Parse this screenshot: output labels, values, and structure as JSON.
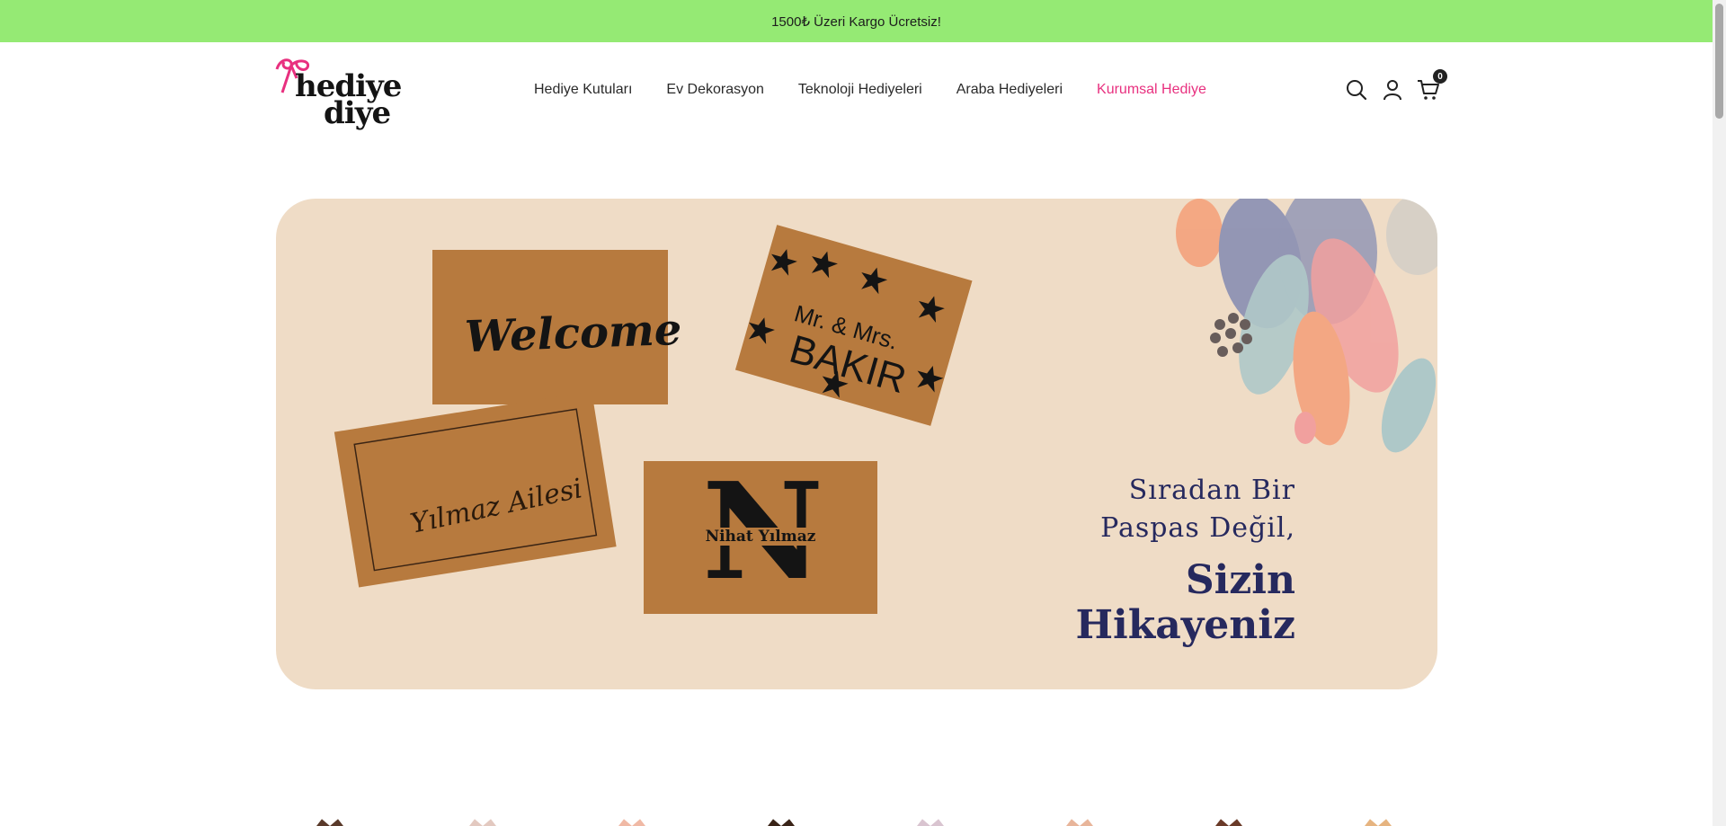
{
  "announcement": {
    "text": "1500₺ Üzeri Kargo Ücretsiz!"
  },
  "header": {
    "logo": {
      "line1": "hediye",
      "line2": "diye"
    },
    "nav": [
      {
        "label": "Hediye Kutuları",
        "active": false
      },
      {
        "label": "Ev Dekorasyon",
        "active": false
      },
      {
        "label": "Teknoloji Hediyeleri",
        "active": false
      },
      {
        "label": "Araba Hediyeleri",
        "active": false
      },
      {
        "label": "Kurumsal Hediye",
        "active": true
      }
    ],
    "icons": {
      "search": "search-icon",
      "account": "user-icon",
      "cart": "cart-icon"
    },
    "cart_count": "0"
  },
  "hero": {
    "line1": "Sıradan Bir",
    "line2": "Paspas Değil,",
    "line3": "Sizin",
    "line4": "Hikayeniz",
    "mats": {
      "welcome": "Welcome",
      "mrmrs_line1": "Mr. & Mrs.",
      "mrmrs_line2": "BAKIR",
      "family": "Yılmaz Ailesi",
      "monogram_letter": "N",
      "monogram_name": "Nihat Yılmaz"
    }
  },
  "colors": {
    "announcement_bg": "#95ea74",
    "accent": "#e8307f",
    "hero_bg": "#efdcc6",
    "hero_text": "#26295e",
    "mat": "#b77a3e"
  }
}
